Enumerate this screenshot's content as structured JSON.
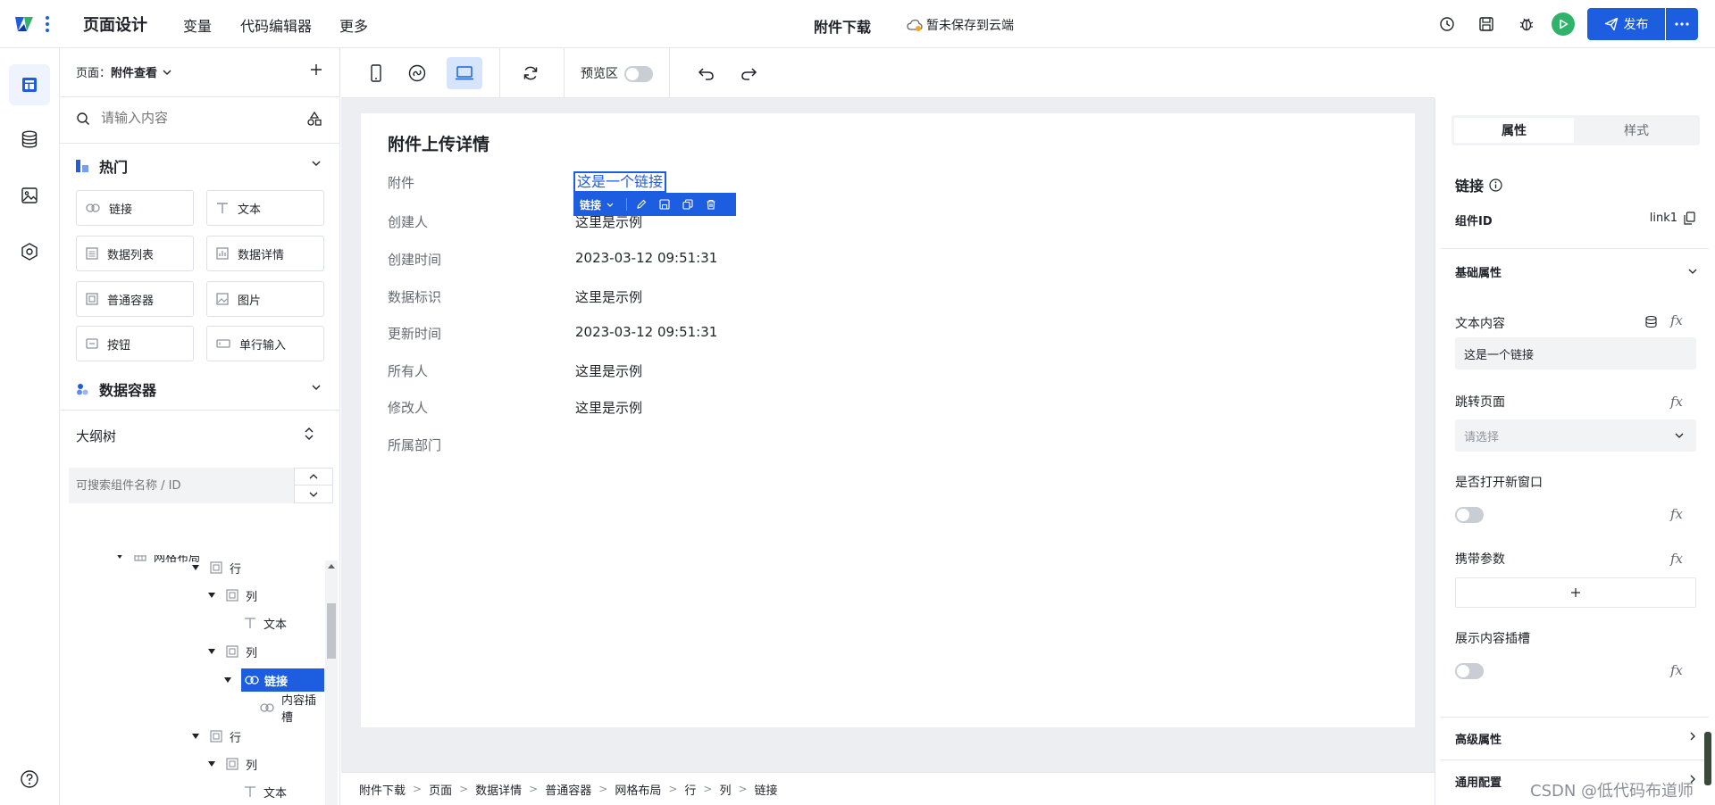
{
  "topbar": {
    "brand": "页面设计",
    "nav": [
      "变量",
      "代码编辑器",
      "更多"
    ],
    "doc_title": "附件下载",
    "save_status": "暂未保存到云端",
    "publish_label": "发布",
    "accent": "#1d5ee0"
  },
  "left": {
    "page_label": "页面：",
    "page_name": "附件查看",
    "search_placeholder": "请输入内容",
    "hot_title": "热门",
    "components": [
      "链接",
      "文本",
      "数据列表",
      "数据详情",
      "普通容器",
      "图片",
      "按钮",
      "单行输入"
    ],
    "data_container_title": "数据容器",
    "outline_title": "大纲树",
    "outline_search_placeholder": "可搜索组件名称 / ID",
    "tree": [
      {
        "label": "网格布局",
        "icon": "grid-icon",
        "level": 0,
        "arrow": true,
        "selected": false
      },
      {
        "label": "行",
        "icon": "container-icon",
        "level": 1,
        "arrow": true,
        "selected": false
      },
      {
        "label": "列",
        "icon": "container-icon",
        "level": 2,
        "arrow": true,
        "selected": false
      },
      {
        "label": "文本",
        "icon": "text-icon",
        "level": 3,
        "arrow": false,
        "selected": false
      },
      {
        "label": "列",
        "icon": "container-icon",
        "level": 2,
        "arrow": true,
        "selected": false
      },
      {
        "label": "链接",
        "icon": "link-icon",
        "level": 3,
        "arrow": true,
        "selected": true
      },
      {
        "label": "内容插槽",
        "icon": "link-icon",
        "level": 4,
        "arrow": false,
        "selected": false
      },
      {
        "label": "行",
        "icon": "container-icon",
        "level": 1,
        "arrow": true,
        "selected": false
      },
      {
        "label": "列",
        "icon": "container-icon",
        "level": 2,
        "arrow": true,
        "selected": false
      },
      {
        "label": "文本",
        "icon": "text-icon",
        "level": 3,
        "arrow": false,
        "selected": false
      },
      {
        "label": "列",
        "icon": "container-icon",
        "level": 2,
        "arrow": true,
        "selected": false
      }
    ]
  },
  "toolbar": {
    "preview_label": "预览区",
    "preview_on": false
  },
  "canvas": {
    "card_title": "附件上传详情",
    "fields": [
      {
        "label": "附件",
        "value": ""
      },
      {
        "label": "创建人",
        "value": "这里是示例"
      },
      {
        "label": "创建时间",
        "value": "2023-03-12 09:51:31"
      },
      {
        "label": "数据标识",
        "value": "这里是示例"
      },
      {
        "label": "更新时间",
        "value": "2023-03-12 09:51:31"
      },
      {
        "label": "所有人",
        "value": "这里是示例"
      },
      {
        "label": "修改人",
        "value": "这里是示例"
      },
      {
        "label": "所属部门",
        "value": ""
      }
    ],
    "link_text": "这是一个链接",
    "selection_chip": "链接",
    "breadcrumb": [
      "附件下载",
      "页面",
      "数据详情",
      "普通容器",
      "网格布局",
      "行",
      "列",
      "链接"
    ]
  },
  "right": {
    "tabs": [
      "属性",
      "样式"
    ],
    "active_tab": 0,
    "component_title": "链接",
    "id_label": "组件ID",
    "id_value": "link1",
    "basic_section": "基础属性",
    "text_content_label": "文本内容",
    "text_content_value": "这是一个链接",
    "jump_page_label": "跳转页面",
    "jump_page_placeholder": "请选择",
    "new_window_label": "是否打开新窗口",
    "params_label": "携带参数",
    "slot_label": "展示内容插槽",
    "advanced_section": "高级属性",
    "common_section": "通用配置",
    "fx": "fx"
  },
  "watermark": "CSDN @低代码布道师"
}
